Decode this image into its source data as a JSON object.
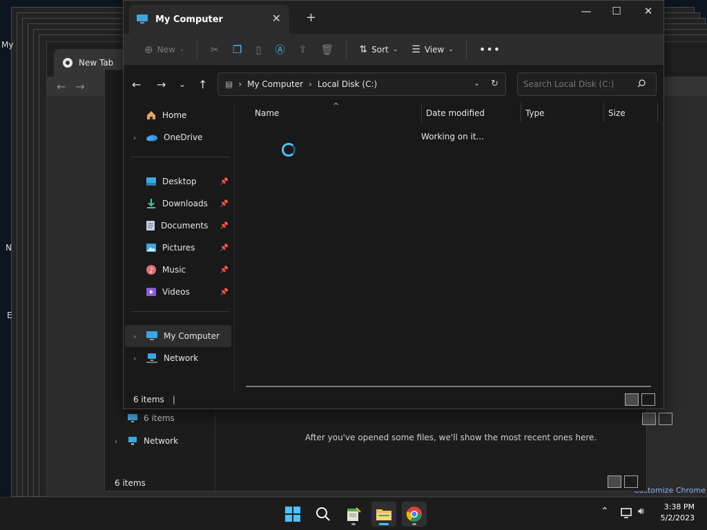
{
  "desktop": {
    "left_labels": [
      "My",
      "N",
      "E"
    ]
  },
  "chrome": {
    "tab_title": "New Tab",
    "customize": "Customize Chrome"
  },
  "mid_window": {
    "items": [
      {
        "label": "6 items"
      },
      {
        "label": "Network"
      }
    ],
    "status": "6 items",
    "recent_msg": "After you've opened some files, we'll show the most recent ones here.",
    "behind_status": "6 items"
  },
  "explorer": {
    "tab_title": "My Computer",
    "toolbar": {
      "new": "New",
      "sort": "Sort",
      "view": "View"
    },
    "breadcrumb": [
      "My Computer",
      "Local Disk (C:)"
    ],
    "search_placeholder": "Search Local Disk (C:)",
    "sidebar": {
      "home": "Home",
      "onedrive": "OneDrive",
      "pinned": [
        "Desktop",
        "Downloads",
        "Documents",
        "Pictures",
        "Music",
        "Videos"
      ],
      "my_computer": "My Computer",
      "network": "Network"
    },
    "columns": [
      "Name",
      "Date modified",
      "Type",
      "Size"
    ],
    "working": "Working on it...",
    "status": "6 items"
  },
  "taskbar": {
    "time": "3:38 PM",
    "date": "5/2/2023"
  },
  "colors": {
    "accent": "#4cc2ff",
    "folder": "#f3c04c",
    "monitor": "#3aa7e0"
  }
}
